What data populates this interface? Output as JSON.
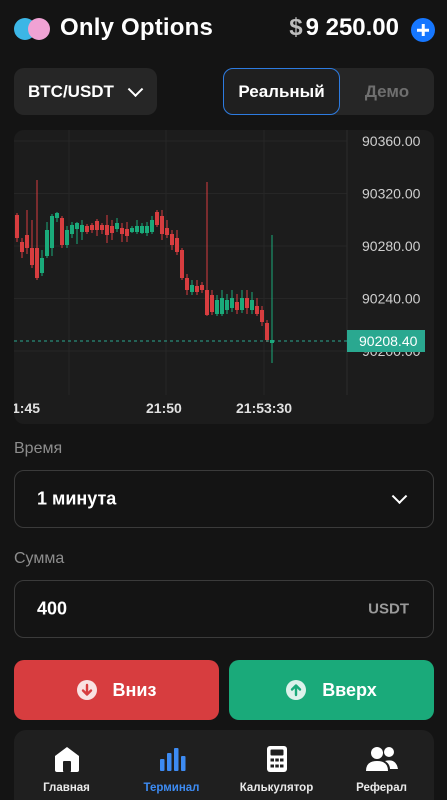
{
  "header": {
    "app_title": "Only Options",
    "balance_currency": "$",
    "balance": "9 250.00",
    "add_funds_icon": "plus-circle-icon"
  },
  "pair": {
    "label": "BTC/USDT"
  },
  "account": {
    "real_label": "Реальный",
    "demo_label": "Демо",
    "active": "real"
  },
  "chart": {
    "price_ticks": [
      "90360.00",
      "90320.00",
      "90280.00",
      "90240.00",
      "90200.00"
    ],
    "time_ticks": [
      "1:45",
      "21:50",
      "21:53:30"
    ],
    "current_price": "90208.40",
    "colors": {
      "up": "#1aaa7a",
      "down": "#d73d3f",
      "grid": "#262626",
      "price_line": "#2aa890"
    }
  },
  "time_field": {
    "label": "Время",
    "value": "1 минута"
  },
  "amount_field": {
    "label": "Сумма",
    "value": "400",
    "unit": "USDT"
  },
  "actions": {
    "down_label": "Вниз",
    "up_label": "Вверх"
  },
  "nav": {
    "items": [
      {
        "label": "Главная",
        "icon": "home-icon"
      },
      {
        "label": "Терминал",
        "icon": "bar-chart-icon"
      },
      {
        "label": "Калькулятор",
        "icon": "calculator-icon"
      },
      {
        "label": "Реферал",
        "icon": "users-icon"
      }
    ],
    "active_index": 1
  }
}
